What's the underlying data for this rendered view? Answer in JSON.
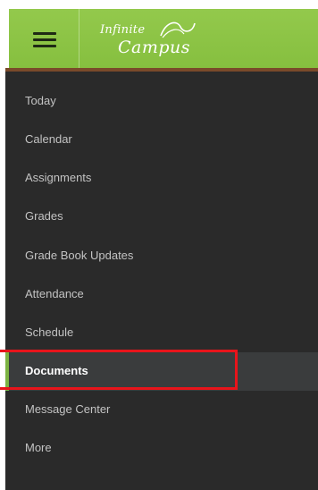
{
  "header": {
    "logo_line1": "Infinite",
    "logo_line2": "Campus",
    "menu_icon": "hamburger-menu-icon",
    "brand_color": "#8cc445"
  },
  "sidebar": {
    "items": [
      {
        "label": "Today"
      },
      {
        "label": "Calendar"
      },
      {
        "label": "Assignments"
      },
      {
        "label": "Grades"
      },
      {
        "label": "Grade Book Updates"
      },
      {
        "label": "Attendance"
      },
      {
        "label": "Schedule"
      },
      {
        "label": "Documents",
        "active": true
      },
      {
        "label": "Message Center"
      },
      {
        "label": "More"
      }
    ],
    "highlight_color": "#e8141b"
  }
}
